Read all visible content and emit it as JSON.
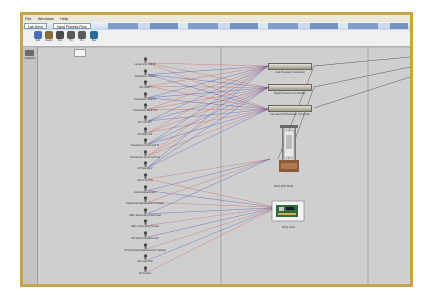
{
  "menu": [
    "File",
    "Windows",
    "Help"
  ],
  "tabs": {
    "left": "Lab Drive",
    "active": "Input Process Flow"
  },
  "toolbar": [
    {
      "label": "Edit",
      "icon": "edit-icon",
      "color": "#4a6fb8"
    },
    {
      "label": "Repair",
      "icon": "wrench-icon",
      "color": "#8a6a3a"
    },
    {
      "label": "Run",
      "icon": "gear-icon",
      "color": "#4a4a4a"
    },
    {
      "label": "Tm",
      "icon": "gear-icon",
      "color": "#5a5a5a"
    },
    {
      "label": "Bn",
      "icon": "gear-icon",
      "color": "#5a5a5a"
    },
    {
      "label": "Stat",
      "icon": "flag-icon",
      "color": "#2a6a9a"
    }
  ],
  "left_panel": {
    "label": "Collection"
  },
  "nodes": [
    "Lamp.Amb Cell Pr",
    "Transducer Cell Pr",
    "AP-CellPr",
    "Transducer Bias Pr",
    "Transducer Back Vol",
    "AP-Trans Pr",
    "AP-Back Vol",
    "Transducer Annul Cell Pr",
    "Transducer Annul Cell Vol",
    "AP-Sample P",
    "AP-Annul Vol",
    "Axial Displacement",
    "Peripheral Displacement Voltage",
    "MEC Secondary Axial Load",
    "MEC Secondary Torque",
    "AP-Shear Displacement",
    "AP-Peripheral Displacement Voltage",
    "AP-Load Cell",
    "AP-Torque"
  ],
  "controllers": [
    {
      "label": "Cell Pressure Controller"
    },
    {
      "label": "Back Pressure Controller"
    },
    {
      "label": "Internal Cell Pressure Controller"
    }
  ],
  "devices": {
    "furnace_label": "GDS-RCTS/HS",
    "daq_label": "DAQ Card"
  },
  "colors": {
    "wire_red": "#d24a4a",
    "wire_blue": "#2e3fb8",
    "wire_black": "#222222"
  }
}
